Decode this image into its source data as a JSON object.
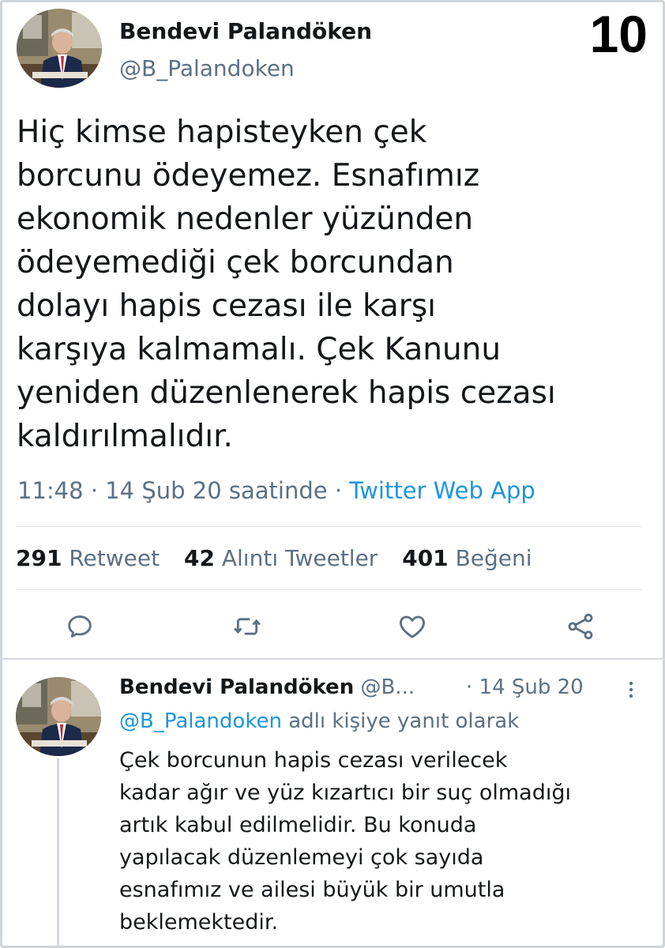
{
  "page_number": "10",
  "tweet": {
    "author_name": "Bendevi Palandöken",
    "author_handle": "@B_Palandoken",
    "text_lines": [
      "Hiç kimse hapisteyken çek",
      "borcunu ödeyemez. Esnafımız",
      "ekonomik nedenler yüzünden",
      "ödeyemediği çek borcundan",
      "dolayı hapis cezası ile karşı",
      "karşıya kalmamalı. Çek Kanunu",
      "yeniden düzenlenerek hapis cezası",
      "kaldırılmalıdır."
    ],
    "time": "11:48",
    "separator": "·",
    "date": "14 Şub 20 saatinde",
    "source": "Twitter Web App",
    "stats": [
      {
        "count": "291",
        "label": "Retweet"
      },
      {
        "count": "42",
        "label": "Alıntı Tweetler"
      },
      {
        "count": "401",
        "label": "Beğeni"
      }
    ],
    "actions": {
      "reply_icon": "reply-icon",
      "retweet_icon": "retweet-icon",
      "like_icon": "heart-icon",
      "share_icon": "share-icon"
    }
  },
  "reply": {
    "author_name": "Bendevi Palandöken",
    "author_handle_truncated": "@B...",
    "date": "· 14 Şub 20",
    "replying_to_mention": "@B_Palandoken",
    "replying_to_suffix": "adlı kişiye yanıt olarak",
    "text_lines": [
      "Çek borcunun hapis cezası verilecek",
      "kadar ağır ve yüz kızartıcı bir suç olmadığı",
      "artık kabul edilmelidir. Bu konuda",
      "yapılacak düzenlemeyi çok sayıda",
      "esnafımız ve ailesi büyük bir umutla",
      "beklemektedir."
    ],
    "more_icon": "more-vertical-icon"
  },
  "colors": {
    "text": "#14171a",
    "secondary": "#5b7083",
    "link": "#1b95e0",
    "divider": "#dde3e8"
  }
}
